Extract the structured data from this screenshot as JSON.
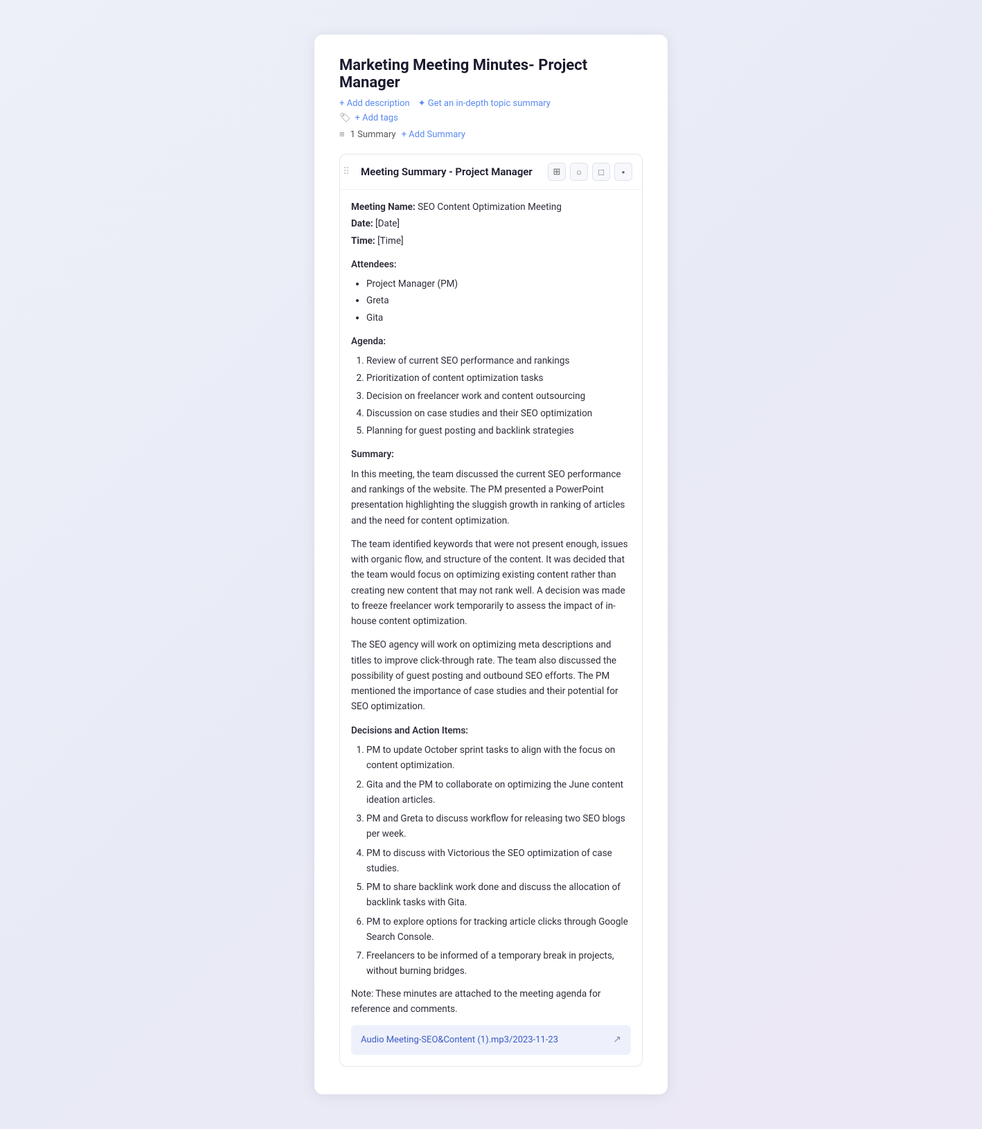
{
  "page": {
    "title": "Marketing Meeting Minutes- Project Manager",
    "add_description_label": "+ Add description",
    "get_summary_label": "✦ Get an in-depth topic summary",
    "add_tags_label": "+ Add tags",
    "summary_count_label": "1 Summary",
    "add_summary_label": "+ Add Summary"
  },
  "summary_card": {
    "title": "Meeting Summary - Project Manager",
    "actions": [
      "grid-icon",
      "circle-icon",
      "square-icon",
      "dot-icon"
    ],
    "meeting_name_label": "Meeting Name:",
    "meeting_name_value": "SEO Content Optimization Meeting",
    "date_label": "Date:",
    "date_value": "[Date]",
    "time_label": "Time:",
    "time_value": "[Time]",
    "attendees_label": "Attendees:",
    "attendees": [
      "Project Manager (PM)",
      "Greta",
      "Gita"
    ],
    "agenda_label": "Agenda:",
    "agenda_items": [
      "Review of current SEO performance and rankings",
      "Prioritization of content optimization tasks",
      "Decision on freelancer work and content outsourcing",
      "Discussion on case studies and their SEO optimization",
      "Planning for guest posting and backlink strategies"
    ],
    "summary_label": "Summary:",
    "paragraphs": [
      "In this meeting, the team discussed the current SEO performance and rankings of the website. The PM presented a PowerPoint presentation highlighting the sluggish growth in ranking of articles and the need for content optimization.",
      "The team identified keywords that were not present enough, issues with organic flow, and structure of the content. It was decided that the team would focus on optimizing existing content rather than creating new content that may not rank well. A decision was made to freeze freelancer work temporarily to assess the impact of in-house content optimization.",
      "The SEO agency will work on optimizing meta descriptions and titles to improve click-through rate. The team also discussed the possibility of guest posting and outbound SEO efforts. The PM mentioned the importance of case studies and their potential for SEO optimization."
    ],
    "decisions_label": "Decisions and Action Items:",
    "action_items": [
      "PM to update October sprint tasks to align with the focus on content optimization.",
      "Gita and the PM to collaborate on optimizing the June content ideation articles.",
      "PM and Greta to discuss workflow for releasing two SEO blogs per week.",
      "PM to discuss with Victorious the SEO optimization of case studies.",
      "PM to share backlink work done and discuss the allocation of backlink tasks with Gita.",
      "PM to explore options for tracking article clicks through Google Search Console.",
      "Freelancers to be informed of a temporary break in projects, without burning bridges."
    ],
    "note_label": "Note:",
    "note_text": "These minutes are attached to the meeting agenda for reference and comments.",
    "attachment_name": "Audio Meeting-SEO&Content (1).mp3/2023-11-23"
  }
}
